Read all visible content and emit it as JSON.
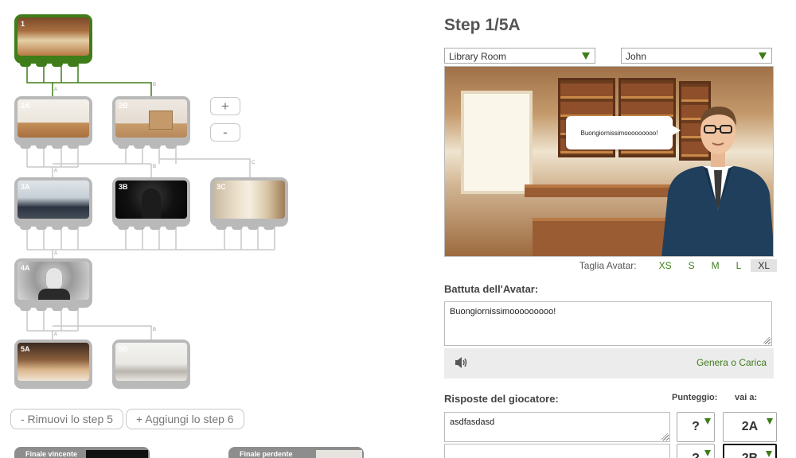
{
  "tree": {
    "nodes": [
      {
        "id": "1"
      },
      {
        "id": "2A"
      },
      {
        "id": "2B"
      },
      {
        "id": "3A"
      },
      {
        "id": "3B"
      },
      {
        "id": "3C"
      },
      {
        "id": "4A"
      },
      {
        "id": "5A"
      },
      {
        "id": "5B"
      }
    ],
    "branch_labels": {
      "a": "A",
      "b": "B",
      "c": "C"
    },
    "add_node_label": "+",
    "remove_node_label": "-",
    "remove_step_label": "- Rimuovi lo step 5",
    "add_step_label": "+ Aggiungi lo step 6",
    "final_win_label": "Finale vincente",
    "final_lose_label": "Finale perdente"
  },
  "panel": {
    "step_title": "Step 1/5A",
    "location_select": "Library Room",
    "avatar_select": "John",
    "speech_bubble": "Buongiornissimooooooooo!",
    "avatar_size_label": "Taglia Avatar:",
    "avatar_sizes": [
      "XS",
      "S",
      "M",
      "L",
      "XL"
    ],
    "selected_size": "XL",
    "line_label": "Battuta dell'Avatar:",
    "line_value": "Buongiornissimooooooooo!",
    "generate_link": "Genera o Carica",
    "answers_label": "Risposte del giocatore:",
    "score_label": "Punteggio:",
    "goto_label": "vai a:",
    "answers": [
      {
        "text": "asdfasdasd",
        "score": "?",
        "goto": "2A"
      },
      {
        "text": "",
        "score": "?",
        "goto": "2B"
      }
    ]
  },
  "colors": {
    "accent": "#3e7d19",
    "node_grey": "#b9b9b9"
  }
}
